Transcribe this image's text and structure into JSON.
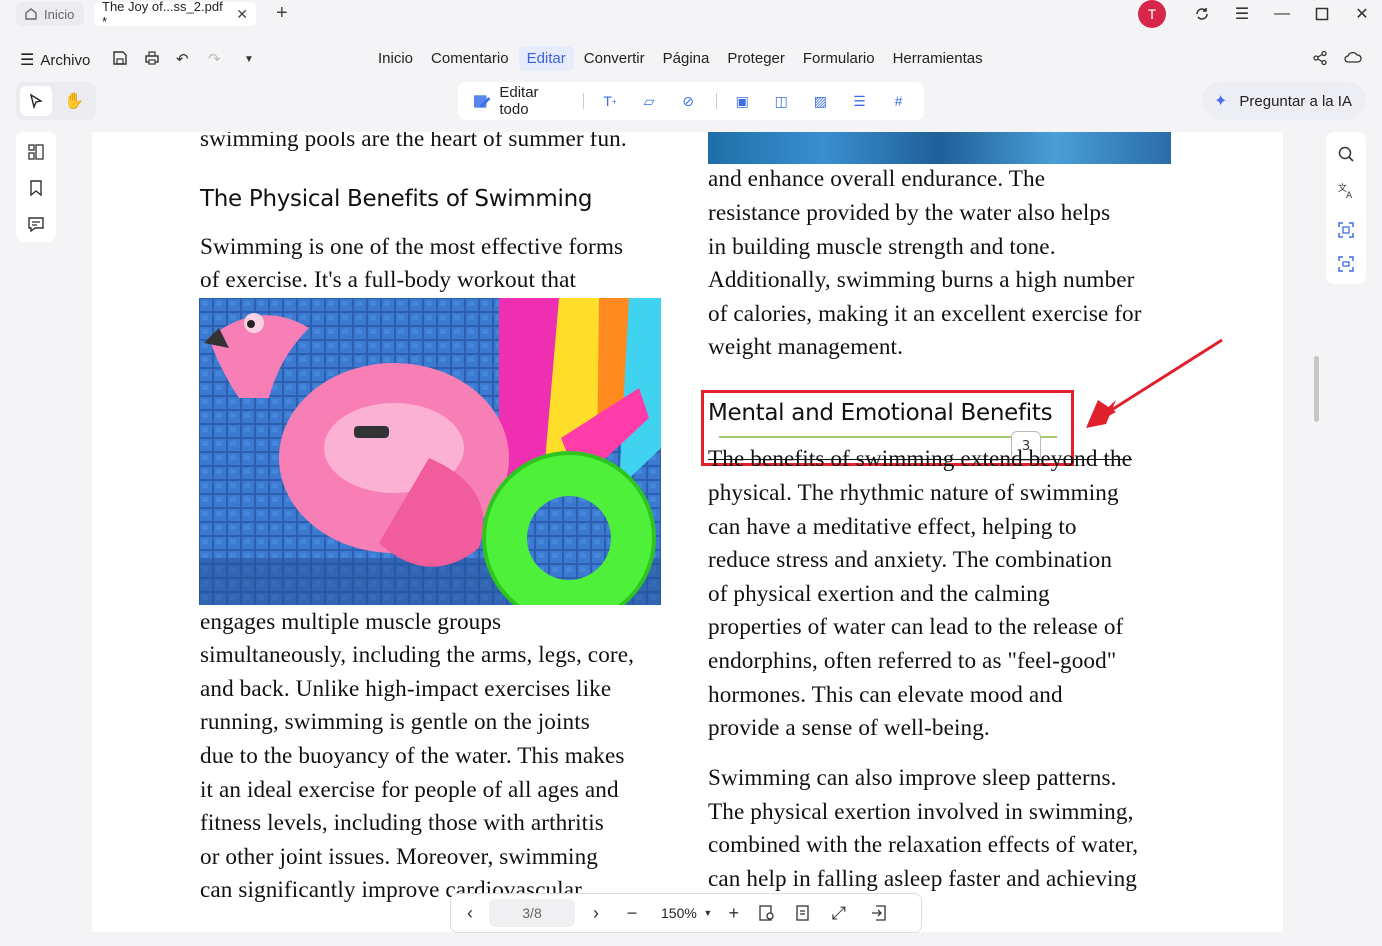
{
  "tabs": {
    "home_label": "Inicio",
    "doc_label": "The Joy of...ss_2.pdf *"
  },
  "user": {
    "avatar_letter": "T",
    "avatar_color": "#d6264a"
  },
  "menubar": {
    "file_label": "Archivo",
    "items": [
      "Inicio",
      "Comentario",
      "Editar",
      "Convertir",
      "Página",
      "Proteger",
      "Formulario",
      "Herramientas"
    ],
    "active": "Editar"
  },
  "toolbar": {
    "edit_all_label": "Editar todo",
    "ask_ai_label": "Preguntar a la IA"
  },
  "document": {
    "left_column": {
      "top_line": "swimming pools are the heart of summer fun.",
      "heading": "The Physical Benefits of Swimming",
      "para1": [
        "Swimming is one of the most effective forms",
        "of exercise. It's a full-body workout that"
      ],
      "para2": [
        "engages multiple muscle groups",
        "simultaneously, including the arms, legs, core,",
        "and back. Unlike high-impact exercises like",
        "running, swimming is gentle on the joints",
        "due to the buoyancy of the water. This makes",
        "it an ideal exercise for people of all ages and",
        "fitness levels, including those with arthritis",
        "or other joint issues. Moreover, swimming",
        "can significantly improve cardiovascular"
      ]
    },
    "right_column": {
      "para1": [
        "and enhance overall endurance. The",
        "resistance provided by the water also helps",
        "in building muscle strength and tone.",
        "Additionally, swimming burns a high number",
        "of calories, making it an excellent exercise for",
        "weight management."
      ],
      "heading": "Mental and Emotional Benefits",
      "heading_badge": "3",
      "para2": [
        "The benefits of swimming extend beyond the",
        "physical. The rhythmic nature of swimming",
        "can have a meditative effect, helping to",
        "reduce stress and anxiety. The combination",
        "of physical exertion and the calming",
        "properties of water can lead to the release of",
        "endorphins, often referred to as \"feel-good\"",
        "hormones. This can elevate mood and",
        "provide a sense of well-being."
      ],
      "para3": [
        "Swimming can also improve sleep patterns.",
        "The physical exertion involved in swimming,",
        "combined with the relaxation effects of water,",
        "can help in falling asleep faster and achieving"
      ]
    }
  },
  "navigation": {
    "page_indicator": "3/8",
    "zoom": "150%"
  },
  "colors": {
    "accent": "#3d63d9",
    "highlight_box": "#e0202a",
    "underline": "#a4c86a"
  }
}
